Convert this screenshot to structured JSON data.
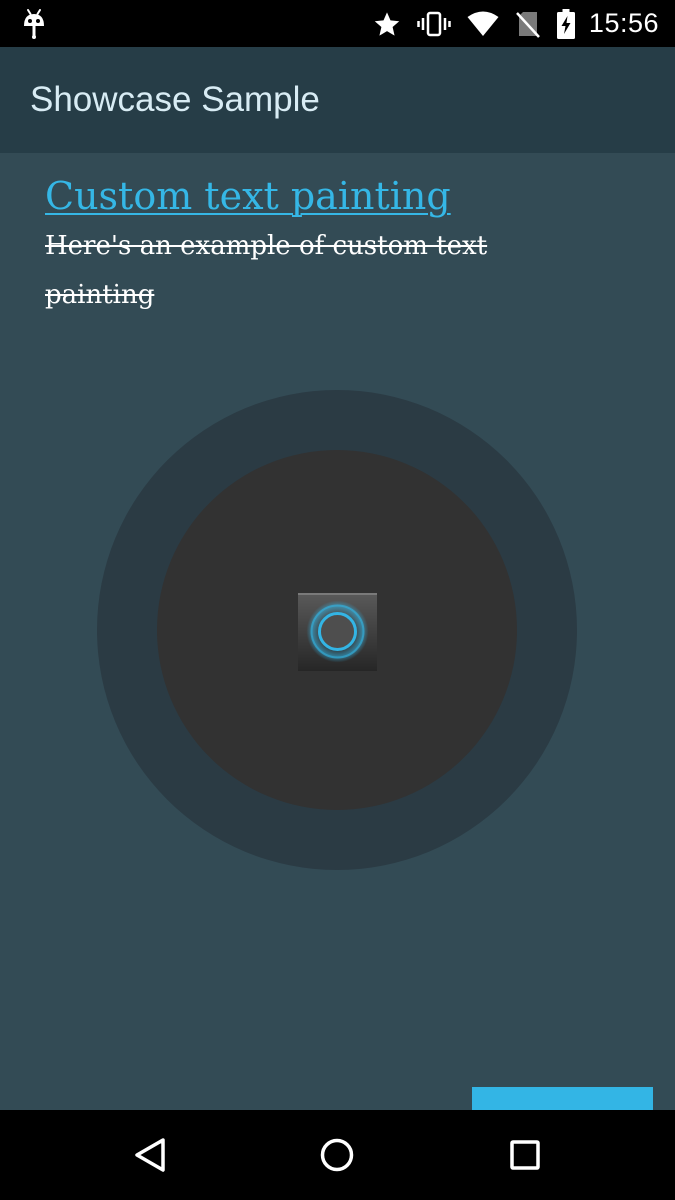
{
  "status_bar": {
    "time": "15:56",
    "icons": [
      "android-debug-icon",
      "star-icon",
      "vibrate-icon",
      "wifi-icon",
      "no-sim-icon",
      "battery-charging-icon"
    ]
  },
  "app_bar": {
    "title": "Showcase Sample"
  },
  "showcase": {
    "title": "Custom text painting",
    "description": "Here's an example of custom text painting",
    "colors": {
      "title": "#35b7e6",
      "description": "#ffffff",
      "outer_ring": "#2b3b44",
      "inner_circle": "#323232",
      "button": "#33b5e5"
    }
  },
  "navigation": {
    "buttons": [
      "back-icon",
      "home-icon",
      "recents-icon"
    ]
  }
}
